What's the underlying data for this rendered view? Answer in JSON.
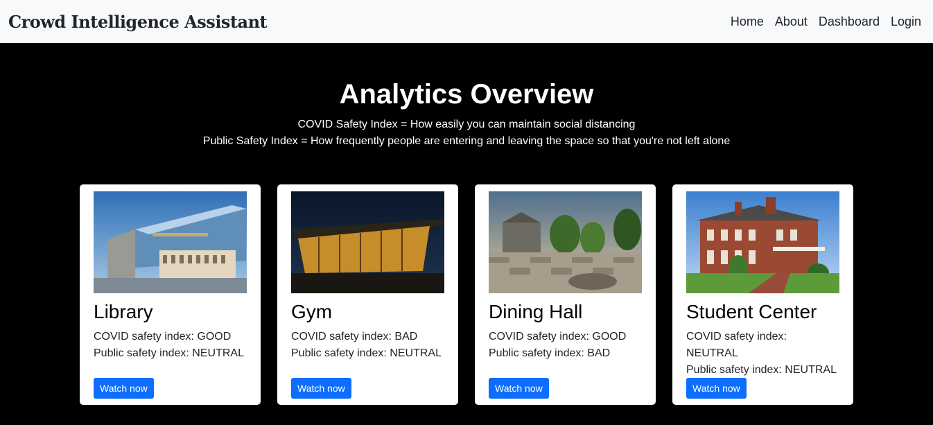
{
  "navbar": {
    "brand": "Crowd Intelligence Assistant",
    "links": [
      "Home",
      "About",
      "Dashboard",
      "Login"
    ]
  },
  "hero": {
    "title": "Analytics Overview",
    "line1": "COVID Safety Index = How easily you can maintain social distancing",
    "line2": "Public Safety Index = How frequently people are entering and leaving the space so that you're not left alone"
  },
  "cards": [
    {
      "title": "Library",
      "covid": "COVID safety index: GOOD",
      "public": "Public safety index: NEUTRAL",
      "button": "Watch now"
    },
    {
      "title": "Gym",
      "covid": "COVID safety index: BAD",
      "public": "Public safety index: NEUTRAL",
      "button": "Watch now"
    },
    {
      "title": "Dining Hall",
      "covid": "COVID safety index: GOOD",
      "public": "Public safety index: BAD",
      "button": "Watch now"
    },
    {
      "title": "Student Center",
      "covid": "COVID safety index: NEUTRAL",
      "public": "Public safety index: NEUTRAL",
      "button": "Watch now"
    }
  ]
}
